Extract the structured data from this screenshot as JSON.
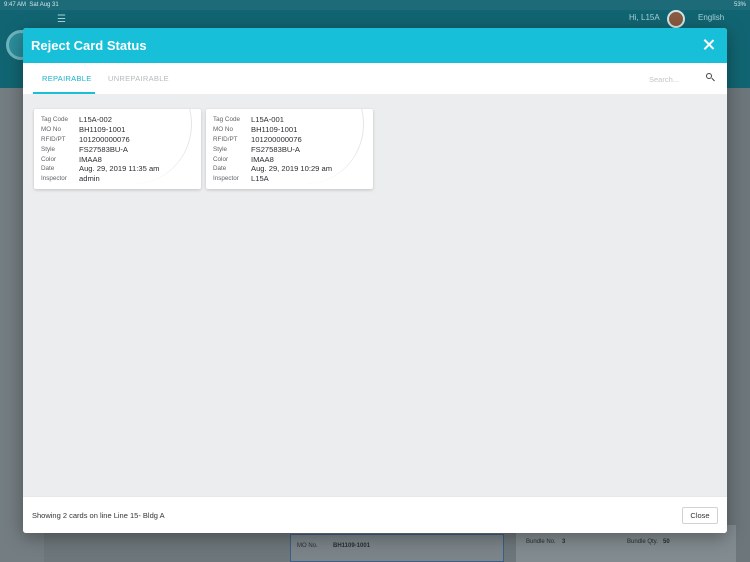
{
  "status_bar": {
    "time": "9:47 AM",
    "date": "Sat Aug 31",
    "battery": "53%"
  },
  "app_header": {
    "greeting": "Hi, L15A",
    "language": "English"
  },
  "background": {
    "mo_label": "MO No.",
    "mo_value": "BH1109-1001",
    "bundle_label": "Bundle No.",
    "bundle_value": "3",
    "bundle_qty_label": "Bundle Qty.",
    "bundle_qty_value": "50"
  },
  "modal": {
    "title": "Reject Card Status",
    "tabs": [
      {
        "label": "REPAIRABLE",
        "active": true
      },
      {
        "label": "UNREPAIRABLE",
        "active": false
      }
    ],
    "search": {
      "placeholder": "Search...",
      "value": ""
    },
    "field_labels": {
      "tag_code": "Tag Code",
      "mo_no": "MO No",
      "rfid": "RFID/PT",
      "style": "Style",
      "color": "Color",
      "date": "Date",
      "inspector": "Inspector"
    },
    "cards": [
      {
        "tag_code": "L15A-002",
        "mo_no": "BH1109-1001",
        "rfid": "101200000076",
        "style": "FS27583BU-A",
        "color": "IMAA8",
        "date": "Aug. 29, 2019 11:35 am",
        "inspector": "admin"
      },
      {
        "tag_code": "L15A-001",
        "mo_no": "BH1109-1001",
        "rfid": "101200000076",
        "style": "FS27583BU-A",
        "color": "IMAA8",
        "date": "Aug. 29, 2019 10:29 am",
        "inspector": "L15A"
      }
    ],
    "footer_text": "Showing 2 cards on line Line 15- Bldg A",
    "close_button": "Close"
  },
  "colors": {
    "accent": "#17bfd8",
    "header_bg": "#116572"
  },
  "icons": {
    "close": "close-icon",
    "search": "search-icon",
    "menu": "hamburger-icon"
  }
}
